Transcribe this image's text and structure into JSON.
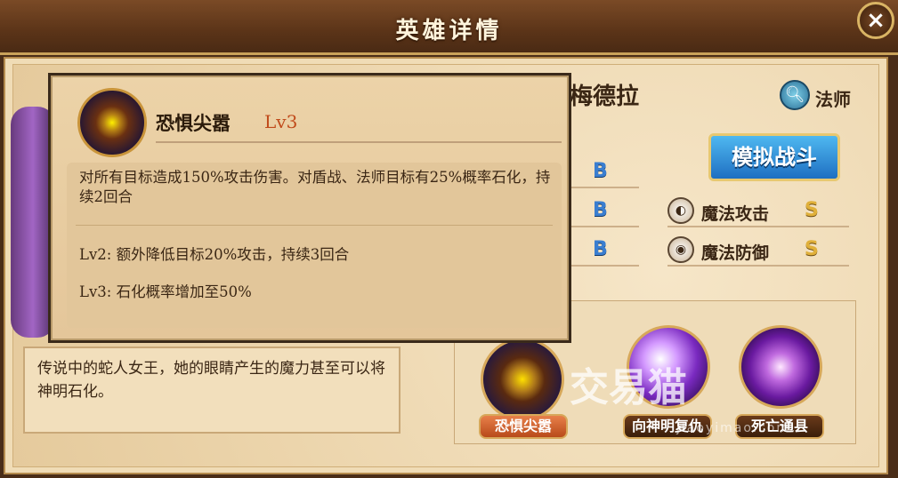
{
  "header": {
    "title": "英雄详情",
    "close_icon": "×"
  },
  "hero": {
    "name": "梅德拉",
    "class_icon": "magnifier-icon",
    "class_label": "法师"
  },
  "simulate_button": "模拟战斗",
  "stats": [
    {
      "grade": "B"
    },
    {
      "grade": "B"
    },
    {
      "grade": "B"
    },
    {
      "icon": "magic-attack-icon",
      "label": "魔法攻击",
      "grade": "S"
    },
    {
      "icon": "magic-defense-icon",
      "label": "魔法防御",
      "grade": "S"
    }
  ],
  "description": "传说中的蛇人女王，她的眼睛产生的魔力甚至可以将神明石化。",
  "skills": [
    {
      "label": "恐惧尖嚣",
      "active": true
    },
    {
      "label": "向神明复仇",
      "active": false
    },
    {
      "label": "死亡通县",
      "active": false
    }
  ],
  "tooltip": {
    "skill_name": "恐惧尖嚣",
    "level": "Lv3",
    "main": "对所有目标造成150%攻击伤害。对盾战、法师目标有25%概率石化，持续2回合",
    "lv2": "Lv2:  额外降低目标20%攻击，持续3回合",
    "lv3": "Lv3:  石化概率增加至50%"
  },
  "watermark": {
    "text": "交易猫",
    "sub": "jiaoyimao.com"
  },
  "colors": {
    "accent": "#c04a1a",
    "button": "#1e6fc2",
    "grade_s": "#e0b03a",
    "grade_b": "#3a7ed0"
  }
}
